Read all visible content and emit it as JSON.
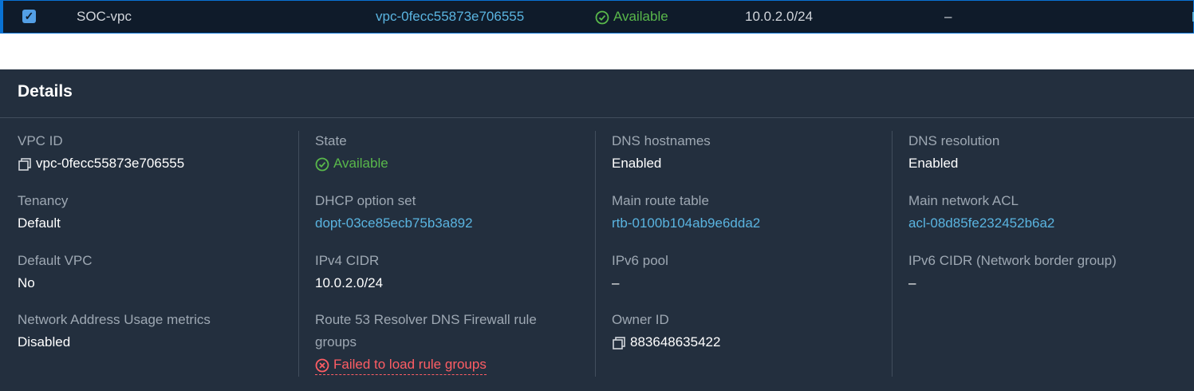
{
  "selected_row": {
    "name": "SOC-vpc",
    "vpc_id": "vpc-0fecc55873e706555",
    "state": "Available",
    "ipv4_cidr": "10.0.2.0/24",
    "extra": "–"
  },
  "details": {
    "title": "Details",
    "vpc_id": {
      "label": "VPC ID",
      "value": "vpc-0fecc55873e706555"
    },
    "tenancy": {
      "label": "Tenancy",
      "value": "Default"
    },
    "default_vpc": {
      "label": "Default VPC",
      "value": "No"
    },
    "nau_metrics": {
      "label": "Network Address Usage metrics",
      "value": "Disabled"
    },
    "state": {
      "label": "State",
      "value": "Available"
    },
    "dhcp": {
      "label": "DHCP option set",
      "value": "dopt-03ce85ecb75b3a892"
    },
    "ipv4_cidr": {
      "label": "IPv4 CIDR",
      "value": "10.0.2.0/24"
    },
    "r53_firewall": {
      "label_line1": "Route 53 Resolver DNS Firewall rule",
      "label_line2": "groups",
      "value": "Failed to load rule groups"
    },
    "dns_hostnames": {
      "label": "DNS hostnames",
      "value": "Enabled"
    },
    "main_route_table": {
      "label": "Main route table",
      "value": "rtb-0100b104ab9e6dda2"
    },
    "ipv6_pool": {
      "label": "IPv6 pool",
      "value": "–"
    },
    "owner_id": {
      "label": "Owner ID",
      "value": "883648635422"
    },
    "dns_resolution": {
      "label": "DNS resolution",
      "value": "Enabled"
    },
    "main_network_acl": {
      "label": "Main network ACL",
      "value": "acl-08d85fe232452b6a2"
    },
    "ipv6_cidr": {
      "label": "IPv6 CIDR (Network border group)",
      "value": "–"
    }
  },
  "colors": {
    "link": "#5ab4e0",
    "success": "#59b84b",
    "error": "#ff5d64",
    "panel_bg": "#232f3e",
    "row_bg": "#0f1b2a",
    "selection_border": "#0972d3"
  },
  "icons": {
    "checkbox": "checked-checkbox-icon",
    "success": "check-circle-icon",
    "error": "x-circle-icon",
    "copy": "copy-icon"
  }
}
